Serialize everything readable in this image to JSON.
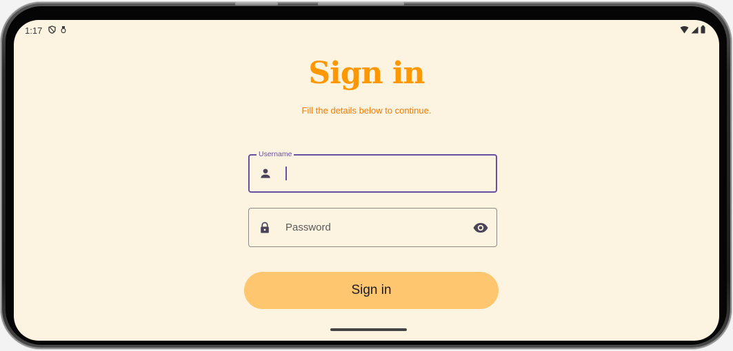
{
  "status_bar": {
    "time": "1:17",
    "left_icons": [
      "shield-icon",
      "tag-icon"
    ],
    "right_icons": [
      "wifi-icon",
      "signal-icon",
      "battery-icon"
    ]
  },
  "screen": {
    "title": "Sign in",
    "subtitle": "Fill the details below to continue."
  },
  "form": {
    "username": {
      "label": "Username",
      "value": "",
      "icon": "person-icon"
    },
    "password": {
      "placeholder": "Password",
      "icon": "lock-icon",
      "toggle_icon": "eye-icon"
    },
    "submit_label": "Sign in"
  },
  "colors": {
    "background": "#fcf3e0",
    "title": "#ff9800",
    "subtitle": "#f57c00",
    "focus_outline": "#6750a4",
    "button": "#ffc670"
  }
}
